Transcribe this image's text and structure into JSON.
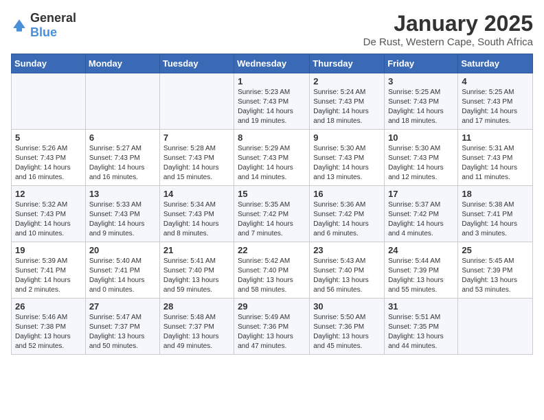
{
  "logo": {
    "general": "General",
    "blue": "Blue"
  },
  "header": {
    "month": "January 2025",
    "location": "De Rust, Western Cape, South Africa"
  },
  "weekdays": [
    "Sunday",
    "Monday",
    "Tuesday",
    "Wednesday",
    "Thursday",
    "Friday",
    "Saturday"
  ],
  "weeks": [
    [
      {
        "day": "",
        "sunrise": "",
        "sunset": "",
        "daylight": ""
      },
      {
        "day": "",
        "sunrise": "",
        "sunset": "",
        "daylight": ""
      },
      {
        "day": "",
        "sunrise": "",
        "sunset": "",
        "daylight": ""
      },
      {
        "day": "1",
        "sunrise": "Sunrise: 5:23 AM",
        "sunset": "Sunset: 7:43 PM",
        "daylight": "Daylight: 14 hours and 19 minutes."
      },
      {
        "day": "2",
        "sunrise": "Sunrise: 5:24 AM",
        "sunset": "Sunset: 7:43 PM",
        "daylight": "Daylight: 14 hours and 18 minutes."
      },
      {
        "day": "3",
        "sunrise": "Sunrise: 5:25 AM",
        "sunset": "Sunset: 7:43 PM",
        "daylight": "Daylight: 14 hours and 18 minutes."
      },
      {
        "day": "4",
        "sunrise": "Sunrise: 5:25 AM",
        "sunset": "Sunset: 7:43 PM",
        "daylight": "Daylight: 14 hours and 17 minutes."
      }
    ],
    [
      {
        "day": "5",
        "sunrise": "Sunrise: 5:26 AM",
        "sunset": "Sunset: 7:43 PM",
        "daylight": "Daylight: 14 hours and 16 minutes."
      },
      {
        "day": "6",
        "sunrise": "Sunrise: 5:27 AM",
        "sunset": "Sunset: 7:43 PM",
        "daylight": "Daylight: 14 hours and 16 minutes."
      },
      {
        "day": "7",
        "sunrise": "Sunrise: 5:28 AM",
        "sunset": "Sunset: 7:43 PM",
        "daylight": "Daylight: 14 hours and 15 minutes."
      },
      {
        "day": "8",
        "sunrise": "Sunrise: 5:29 AM",
        "sunset": "Sunset: 7:43 PM",
        "daylight": "Daylight: 14 hours and 14 minutes."
      },
      {
        "day": "9",
        "sunrise": "Sunrise: 5:30 AM",
        "sunset": "Sunset: 7:43 PM",
        "daylight": "Daylight: 14 hours and 13 minutes."
      },
      {
        "day": "10",
        "sunrise": "Sunrise: 5:30 AM",
        "sunset": "Sunset: 7:43 PM",
        "daylight": "Daylight: 14 hours and 12 minutes."
      },
      {
        "day": "11",
        "sunrise": "Sunrise: 5:31 AM",
        "sunset": "Sunset: 7:43 PM",
        "daylight": "Daylight: 14 hours and 11 minutes."
      }
    ],
    [
      {
        "day": "12",
        "sunrise": "Sunrise: 5:32 AM",
        "sunset": "Sunset: 7:43 PM",
        "daylight": "Daylight: 14 hours and 10 minutes."
      },
      {
        "day": "13",
        "sunrise": "Sunrise: 5:33 AM",
        "sunset": "Sunset: 7:43 PM",
        "daylight": "Daylight: 14 hours and 9 minutes."
      },
      {
        "day": "14",
        "sunrise": "Sunrise: 5:34 AM",
        "sunset": "Sunset: 7:43 PM",
        "daylight": "Daylight: 14 hours and 8 minutes."
      },
      {
        "day": "15",
        "sunrise": "Sunrise: 5:35 AM",
        "sunset": "Sunset: 7:42 PM",
        "daylight": "Daylight: 14 hours and 7 minutes."
      },
      {
        "day": "16",
        "sunrise": "Sunrise: 5:36 AM",
        "sunset": "Sunset: 7:42 PM",
        "daylight": "Daylight: 14 hours and 6 minutes."
      },
      {
        "day": "17",
        "sunrise": "Sunrise: 5:37 AM",
        "sunset": "Sunset: 7:42 PM",
        "daylight": "Daylight: 14 hours and 4 minutes."
      },
      {
        "day": "18",
        "sunrise": "Sunrise: 5:38 AM",
        "sunset": "Sunset: 7:41 PM",
        "daylight": "Daylight: 14 hours and 3 minutes."
      }
    ],
    [
      {
        "day": "19",
        "sunrise": "Sunrise: 5:39 AM",
        "sunset": "Sunset: 7:41 PM",
        "daylight": "Daylight: 14 hours and 2 minutes."
      },
      {
        "day": "20",
        "sunrise": "Sunrise: 5:40 AM",
        "sunset": "Sunset: 7:41 PM",
        "daylight": "Daylight: 14 hours and 0 minutes."
      },
      {
        "day": "21",
        "sunrise": "Sunrise: 5:41 AM",
        "sunset": "Sunset: 7:40 PM",
        "daylight": "Daylight: 13 hours and 59 minutes."
      },
      {
        "day": "22",
        "sunrise": "Sunrise: 5:42 AM",
        "sunset": "Sunset: 7:40 PM",
        "daylight": "Daylight: 13 hours and 58 minutes."
      },
      {
        "day": "23",
        "sunrise": "Sunrise: 5:43 AM",
        "sunset": "Sunset: 7:40 PM",
        "daylight": "Daylight: 13 hours and 56 minutes."
      },
      {
        "day": "24",
        "sunrise": "Sunrise: 5:44 AM",
        "sunset": "Sunset: 7:39 PM",
        "daylight": "Daylight: 13 hours and 55 minutes."
      },
      {
        "day": "25",
        "sunrise": "Sunrise: 5:45 AM",
        "sunset": "Sunset: 7:39 PM",
        "daylight": "Daylight: 13 hours and 53 minutes."
      }
    ],
    [
      {
        "day": "26",
        "sunrise": "Sunrise: 5:46 AM",
        "sunset": "Sunset: 7:38 PM",
        "daylight": "Daylight: 13 hours and 52 minutes."
      },
      {
        "day": "27",
        "sunrise": "Sunrise: 5:47 AM",
        "sunset": "Sunset: 7:37 PM",
        "daylight": "Daylight: 13 hours and 50 minutes."
      },
      {
        "day": "28",
        "sunrise": "Sunrise: 5:48 AM",
        "sunset": "Sunset: 7:37 PM",
        "daylight": "Daylight: 13 hours and 49 minutes."
      },
      {
        "day": "29",
        "sunrise": "Sunrise: 5:49 AM",
        "sunset": "Sunset: 7:36 PM",
        "daylight": "Daylight: 13 hours and 47 minutes."
      },
      {
        "day": "30",
        "sunrise": "Sunrise: 5:50 AM",
        "sunset": "Sunset: 7:36 PM",
        "daylight": "Daylight: 13 hours and 45 minutes."
      },
      {
        "day": "31",
        "sunrise": "Sunrise: 5:51 AM",
        "sunset": "Sunset: 7:35 PM",
        "daylight": "Daylight: 13 hours and 44 minutes."
      },
      {
        "day": "",
        "sunrise": "",
        "sunset": "",
        "daylight": ""
      }
    ]
  ]
}
